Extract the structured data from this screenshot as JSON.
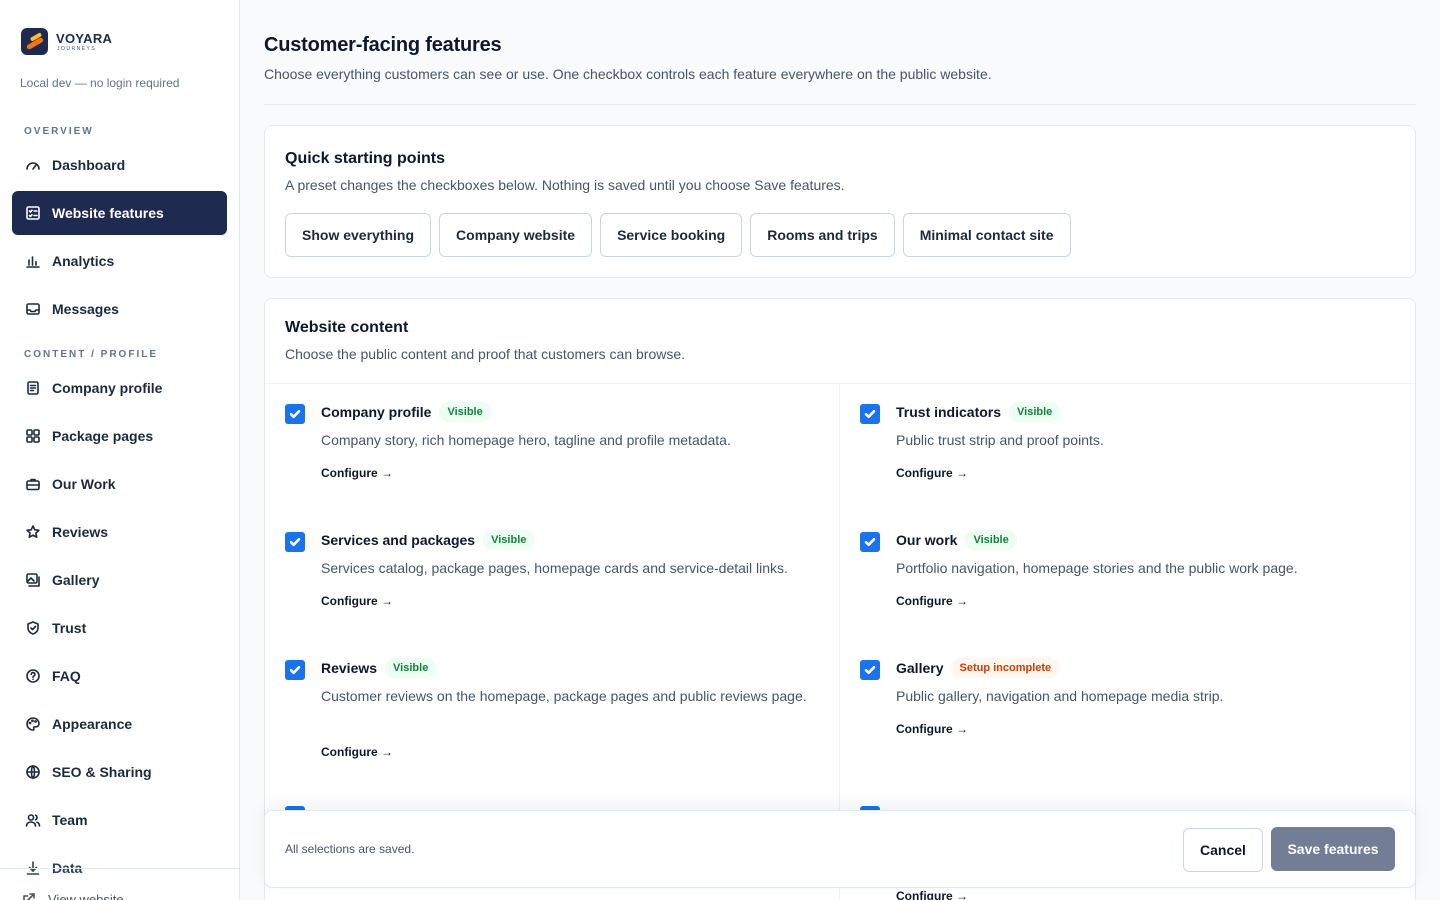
{
  "sidebar": {
    "brand_name": "VOYARA",
    "brand_sub": "JOURNEYS",
    "local_note": "Local dev — no login required",
    "headings": {
      "overview": "OVERVIEW",
      "content": "CONTENT / PROFILE"
    },
    "items": [
      {
        "label": "Dashboard",
        "icon": "gauge-icon"
      },
      {
        "label": "Website features",
        "icon": "checklist-icon",
        "active": true
      },
      {
        "label": "Analytics",
        "icon": "bar-chart-icon"
      },
      {
        "label": "Messages",
        "icon": "inbox-icon"
      },
      {
        "label": "Company profile",
        "icon": "document-icon"
      },
      {
        "label": "Package pages",
        "icon": "grid-icon"
      },
      {
        "label": "Our Work",
        "icon": "briefcase-icon"
      },
      {
        "label": "Reviews",
        "icon": "star-icon"
      },
      {
        "label": "Gallery",
        "icon": "images-icon"
      },
      {
        "label": "Trust",
        "icon": "shield-icon"
      },
      {
        "label": "FAQ",
        "icon": "help-circle-icon"
      },
      {
        "label": "Appearance",
        "icon": "palette-icon"
      },
      {
        "label": "SEO & Sharing",
        "icon": "globe-icon"
      },
      {
        "label": "Team",
        "icon": "users-icon"
      },
      {
        "label": "Data",
        "icon": "download-icon"
      }
    ],
    "footer_label": "View website"
  },
  "page": {
    "title": "Customer-facing features",
    "subtitle": "Choose everything customers can see or use. One checkbox controls each feature everywhere on the public website."
  },
  "presets": {
    "title": "Quick starting points",
    "subtitle": "A preset changes the checkboxes below. Nothing is saved until you choose Save features.",
    "buttons": [
      "Show everything",
      "Company website",
      "Service booking",
      "Rooms and trips",
      "Minimal contact site"
    ]
  },
  "content": {
    "title": "Website content",
    "subtitle": "Choose the public content and proof that customers can browse.",
    "configure_label": "Configure →",
    "features": [
      {
        "title": "Company profile",
        "badge": "Visible",
        "status": "visible",
        "checked": true,
        "desc": "Company story, rich homepage hero, tagline and profile metadata."
      },
      {
        "title": "Trust indicators",
        "badge": "Visible",
        "status": "visible",
        "checked": true,
        "desc": "Public trust strip and proof points."
      },
      {
        "title": "Services and packages",
        "badge": "Visible",
        "status": "visible",
        "checked": true,
        "desc": "Services catalog, package pages, homepage cards and service-detail links."
      },
      {
        "title": "Our work",
        "badge": "Visible",
        "status": "visible",
        "checked": true,
        "desc": "Portfolio navigation, homepage stories and the public work page."
      },
      {
        "title": "Reviews",
        "badge": "Visible",
        "status": "visible",
        "checked": true,
        "desc": "Customer reviews on the homepage, package pages and public reviews page."
      },
      {
        "title": "Gallery",
        "badge": "Setup incomplete",
        "status": "incomplete",
        "checked": true,
        "desc": "Public gallery, navigation and homepage media strip."
      }
    ]
  },
  "savebar": {
    "status": "All selections are saved.",
    "cancel_label": "Cancel",
    "save_label": "Save features"
  }
}
